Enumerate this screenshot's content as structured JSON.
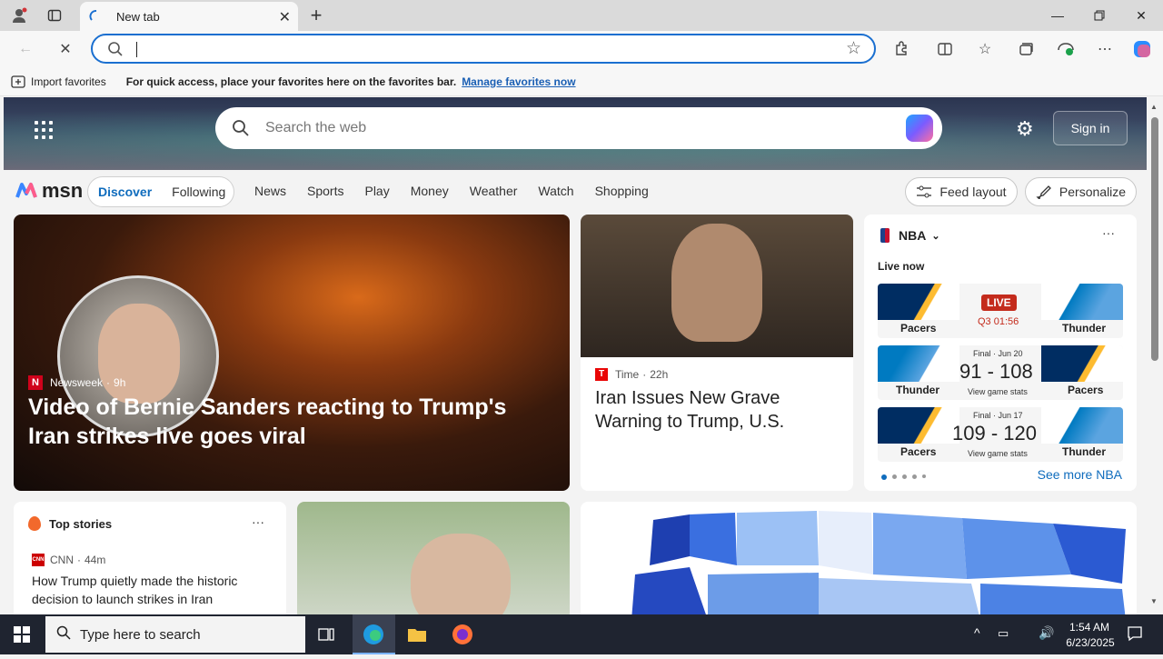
{
  "browser": {
    "tab_title": "New tab",
    "address_value": "",
    "fav_import": "Import favorites",
    "fav_message": "For quick access, place your favorites here on the favorites bar.",
    "fav_link": "Manage favorites now"
  },
  "msn": {
    "search_placeholder": "Search the web",
    "signin": "Sign in",
    "logo_text": "msn",
    "seg_discover": "Discover",
    "seg_following": "Following",
    "nav": [
      "News",
      "Sports",
      "Play",
      "Money",
      "Weather",
      "Watch",
      "Shopping"
    ],
    "feed_layout": "Feed layout",
    "personalize": "Personalize"
  },
  "big_story": {
    "source": "Newsweek",
    "age": "9h",
    "title": "Video of Bernie Sanders reacting to Trump's Iran strikes live goes viral"
  },
  "mid_story": {
    "source": "Time",
    "age": "22h",
    "title": "Iran Issues New Grave Warning to Trump, U.S."
  },
  "nba": {
    "league": "NBA",
    "live_now": "Live now",
    "see_more": "See more NBA",
    "games": [
      {
        "left": "Pacers",
        "right": "Thunder",
        "status": "LIVE",
        "clock": "Q3 01:56"
      },
      {
        "left": "Thunder",
        "right": "Pacers",
        "meta": "Final · Jun 20",
        "score": "91 - 108",
        "stats": "View game stats"
      },
      {
        "left": "Pacers",
        "right": "Thunder",
        "meta": "Final · Jun 17",
        "score": "109 - 120",
        "stats": "View game stats"
      }
    ]
  },
  "top_stories": {
    "title": "Top stories",
    "source": "CNN",
    "age": "44m",
    "headline": "How Trump quietly made the historic decision to launch strikes in Iran"
  },
  "taskbar": {
    "search_placeholder": "Type here to search",
    "time": "1:54 AM",
    "date": "6/23/2025"
  },
  "colors": {
    "accent": "#0f6cbd",
    "live_red": "#c42b1c",
    "taskbar": "#1f2430"
  }
}
